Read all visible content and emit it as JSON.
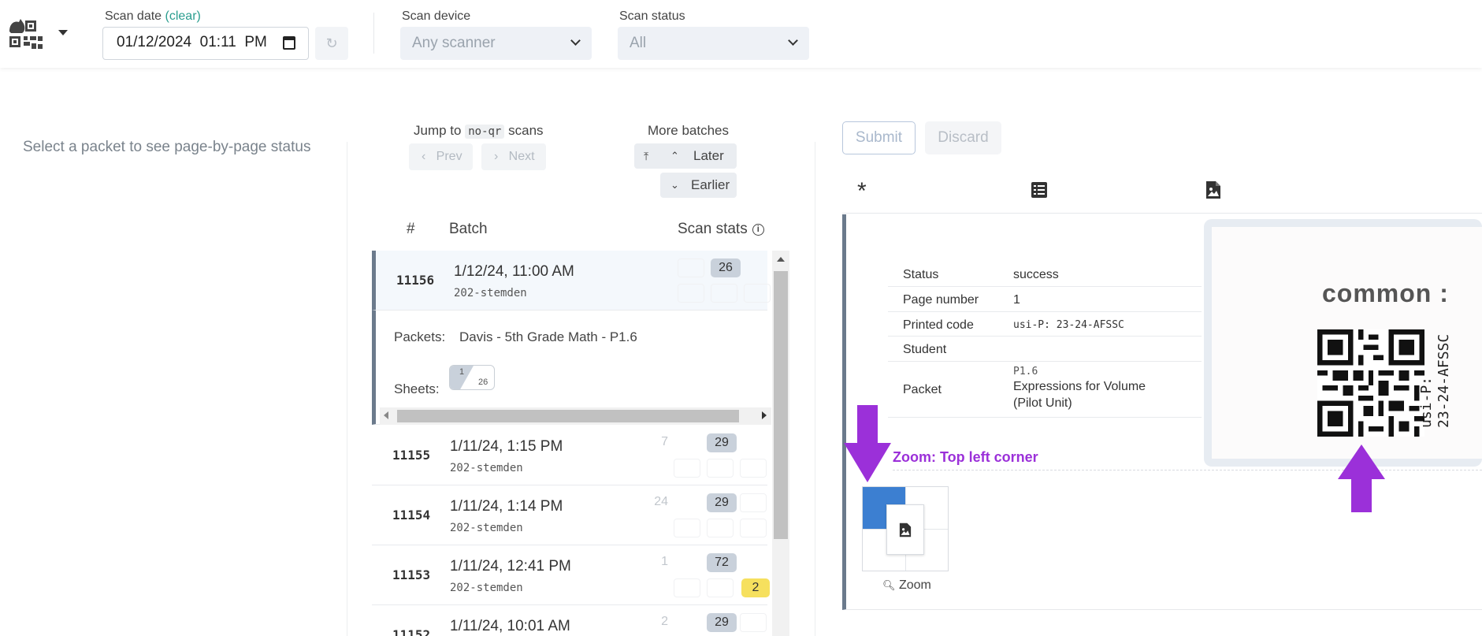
{
  "header": {
    "scan_date_label": "Scan date",
    "scan_date_clear": "(clear)",
    "scan_date_value": "01/12/2024  01:11  PM",
    "scan_device_label": "Scan device",
    "scan_device_value": "Any scanner",
    "scan_status_label": "Scan status",
    "scan_status_value": "All"
  },
  "left": {
    "hint": "Select a packet to see page-by-page status"
  },
  "middle": {
    "jump_prefix": "Jump to",
    "jump_code": "no-qr",
    "jump_suffix": "scans",
    "prev_label": "Prev",
    "next_label": "Next",
    "more_batches_label": "More batches",
    "later_label": "Later",
    "earlier_label": "Earlier",
    "col_num": "#",
    "col_batch": "Batch",
    "col_stats": "Scan stats",
    "rows": [
      {
        "num": "11156",
        "date": "1/12/24, 11:00 AM",
        "user": "202-stemden",
        "faint": "",
        "total": "26",
        "warn": ""
      },
      {
        "num": "11155",
        "date": "1/11/24, 1:15 PM",
        "user": "202-stemden",
        "faint": "7",
        "total": "29",
        "warn": ""
      },
      {
        "num": "11154",
        "date": "1/11/24, 1:14 PM",
        "user": "202-stemden",
        "faint": "24",
        "total": "29",
        "warn": ""
      },
      {
        "num": "11153",
        "date": "1/11/24, 12:41 PM",
        "user": "202-stemden",
        "faint": "1",
        "total": "72",
        "warn": "2"
      },
      {
        "num": "11152",
        "date": "1/11/24, 10:01 AM",
        "user": "",
        "faint": "2",
        "total": "29",
        "warn": ""
      }
    ],
    "expanded": {
      "packets_label": "Packets:",
      "packets_value": "Davis - 5th Grade Math - P1.6",
      "sheets_label": "Sheets:",
      "sheet_done": "1",
      "sheet_total": "26"
    }
  },
  "right": {
    "submit_label": "Submit",
    "discard_label": "Discard",
    "tab_icons": [
      "asterisk-icon",
      "list-icon",
      "file-image-icon"
    ],
    "details": {
      "status_key": "Status",
      "status_val": "success",
      "page_key": "Page number",
      "page_val": "1",
      "printed_key": "Printed code",
      "printed_val": "usi-P: 23-24-AFSSC",
      "student_key": "Student",
      "student_val": "",
      "packet_key": "Packet",
      "packet_code": "P1.6",
      "packet_line1": "Expressions for Volume",
      "packet_line2": "(Pilot Unit)"
    },
    "preview": {
      "faded_text": "common :",
      "code_line1": "usi-P:",
      "code_line2": "23-24-AFSSC"
    },
    "zoom_annotation": "Zoom: Top left corner",
    "zoom_label": "Zoom",
    "annotation_color": "#9b30d9"
  }
}
